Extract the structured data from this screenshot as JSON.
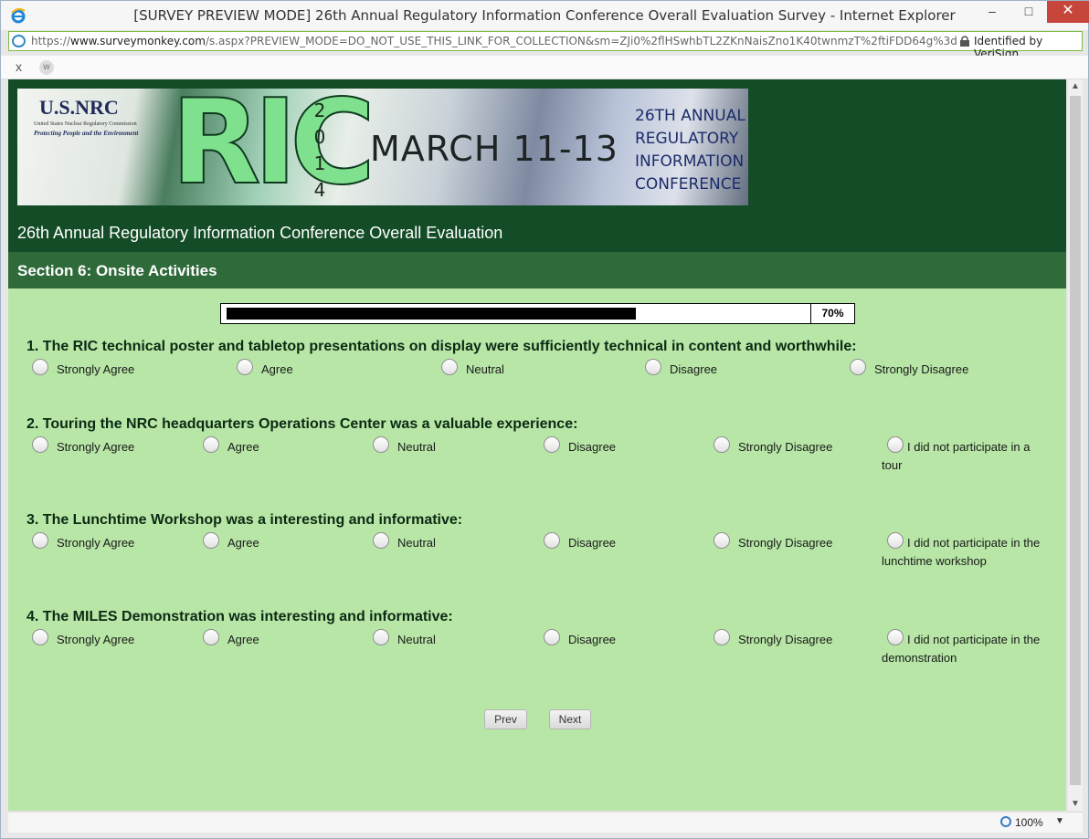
{
  "window": {
    "title": "[SURVEY PREVIEW MODE] 26th Annual Regulatory Information Conference Overall Evaluation Survey - Internet Explorer",
    "minimize": "–",
    "maximize": "□",
    "close": "✕"
  },
  "address": {
    "scheme": "https://",
    "host": "www.surveymonkey.com",
    "path": "/s.aspx?PREVIEW_MODE=DO_NOT_USE_THIS_LINK_FOR_COLLECTION&sm=ZJi0%2flHSwhbTL2ZKnNaisZno1K40twnmzT%2ftiFDD64g%3d",
    "identity": "Identified by VeriSign"
  },
  "tabs": {
    "close": "x",
    "tab_icon": "w"
  },
  "banner": {
    "org": "U.S.NRC",
    "org_sub": "United States Nuclear Regulatory Commission",
    "org_tag": "Protecting People and the Environment",
    "logo_text": "RIC",
    "year_digits": [
      "2",
      "0",
      "1",
      "4"
    ],
    "dates": "MARCH 11-13",
    "annual": [
      "26TH ANNUAL",
      "REGULATORY",
      "INFORMATION",
      "CONFERENCE"
    ]
  },
  "survey": {
    "title": "26th Annual Regulatory Information Conference Overall Evaluation",
    "section": "Section 6: Onsite Activities",
    "progress_label": "70%",
    "progress_fraction": 0.7
  },
  "questions": [
    {
      "title": "1. The RIC technical poster and tabletop presentations on display were sufficiently technical in content and worthwhile:",
      "options": [
        "Strongly Agree",
        "Agree",
        "Neutral",
        "Disagree",
        "Strongly Disagree"
      ]
    },
    {
      "title": "2. Touring the NRC headquarters Operations Center was a valuable experience:",
      "options": [
        "Strongly Agree",
        "Agree",
        "Neutral",
        "Disagree",
        "Strongly Disagree",
        "I did not participate in a tour"
      ]
    },
    {
      "title": "3. The Lunchtime Workshop was a interesting and informative:",
      "options": [
        "Strongly Agree",
        "Agree",
        "Neutral",
        "Disagree",
        "Strongly Disagree",
        "I did not participate in the lunchtime workshop"
      ]
    },
    {
      "title": "4. The MILES Demonstration was interesting and informative:",
      "options": [
        "Strongly Agree",
        "Agree",
        "Neutral",
        "Disagree",
        "Strongly Disagree",
        "I did not participate in the demonstration"
      ]
    }
  ],
  "nav": {
    "prev": "Prev",
    "next": "Next"
  },
  "status": {
    "zoom": "100%"
  }
}
